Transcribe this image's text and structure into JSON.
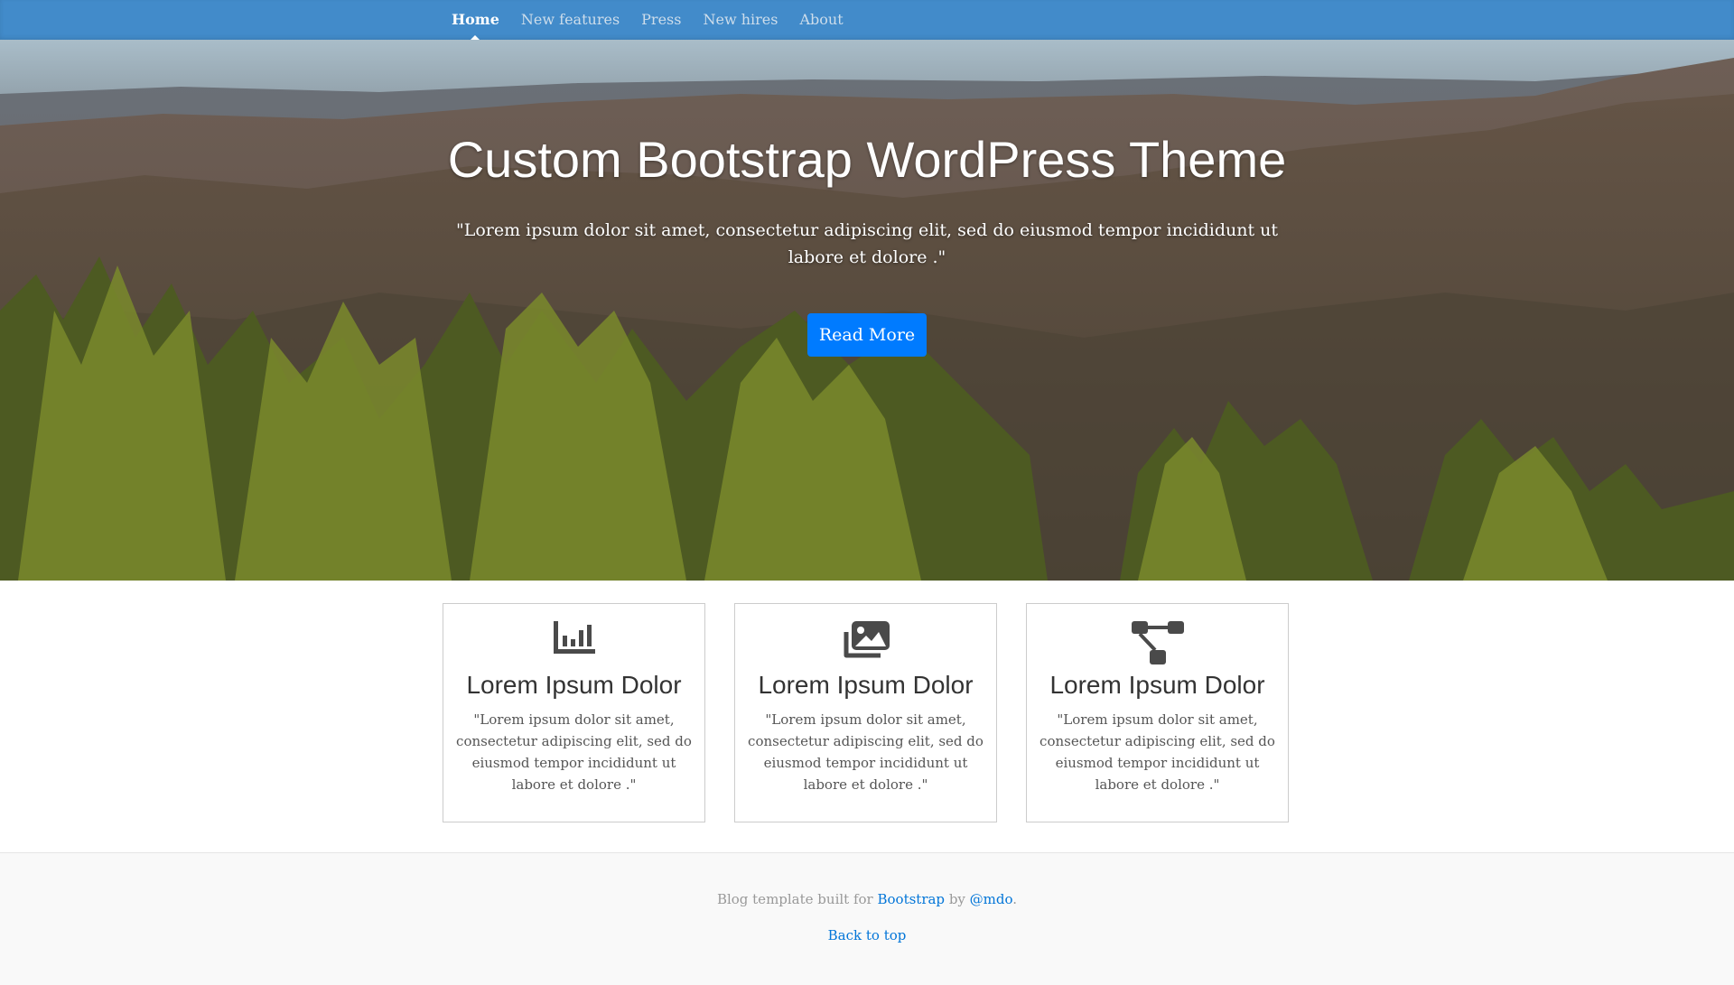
{
  "nav": {
    "items": [
      {
        "label": "Home",
        "active": true
      },
      {
        "label": "New features"
      },
      {
        "label": "Press"
      },
      {
        "label": "New hires"
      },
      {
        "label": "About"
      }
    ]
  },
  "hero": {
    "title": "Custom Bootstrap WordPress Theme",
    "lead": "\"Lorem ipsum dolor sit amet, consectetur adipiscing elit, sed do eiusmod tempor incididunt ut labore et dolore .\"",
    "button_label": "Read More"
  },
  "features": [
    {
      "icon": "bar-chart-icon",
      "title": "Lorem Ipsum Dolor",
      "text": "\"Lorem ipsum dolor sit amet, consectetur adipiscing elit, sed do eiusmod tempor incididunt ut labore et dolore .\""
    },
    {
      "icon": "images-icon",
      "title": "Lorem Ipsum Dolor",
      "text": "\"Lorem ipsum dolor sit amet, consectetur adipiscing elit, sed do eiusmod tempor incididunt ut labore et dolore .\""
    },
    {
      "icon": "sitemap-icon",
      "title": "Lorem Ipsum Dolor",
      "text": "\"Lorem ipsum dolor sit amet, consectetur adipiscing elit, sed do eiusmod tempor incididunt ut labore et dolore .\""
    }
  ],
  "footer": {
    "prefix": "Blog template built for ",
    "bootstrap_link": "Bootstrap",
    "middle": " by ",
    "mdo_link": "@mdo",
    "suffix": ".",
    "back_to_top": "Back to top"
  },
  "colors": {
    "navbar": "#428bca",
    "button": "#007bff",
    "link": "#0275d8"
  }
}
